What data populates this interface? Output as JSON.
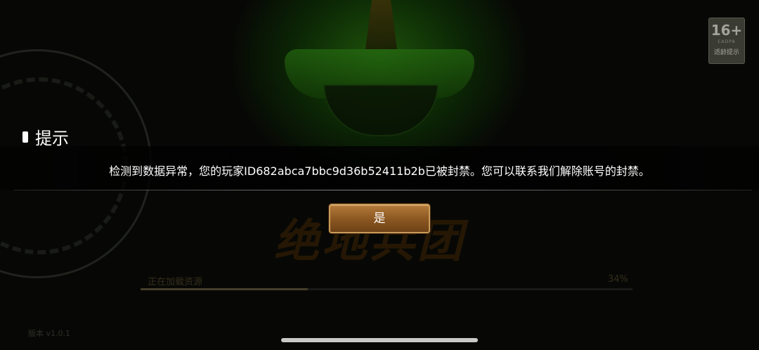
{
  "age_rating": {
    "number": "16+",
    "org": "CADPA",
    "caption": "适龄提示"
  },
  "loading": {
    "label": "正在加载资源",
    "percent": "34%",
    "progress": 0.34
  },
  "footer": {
    "version": "版本 v1.0.1"
  },
  "dialog": {
    "title": "提示",
    "message": "检测到数据异常，您的玩家ID682abca7bbc9d36b52411b2b已被封禁。您可以联系我们解除账号的封禁。",
    "confirm_label": "是"
  }
}
